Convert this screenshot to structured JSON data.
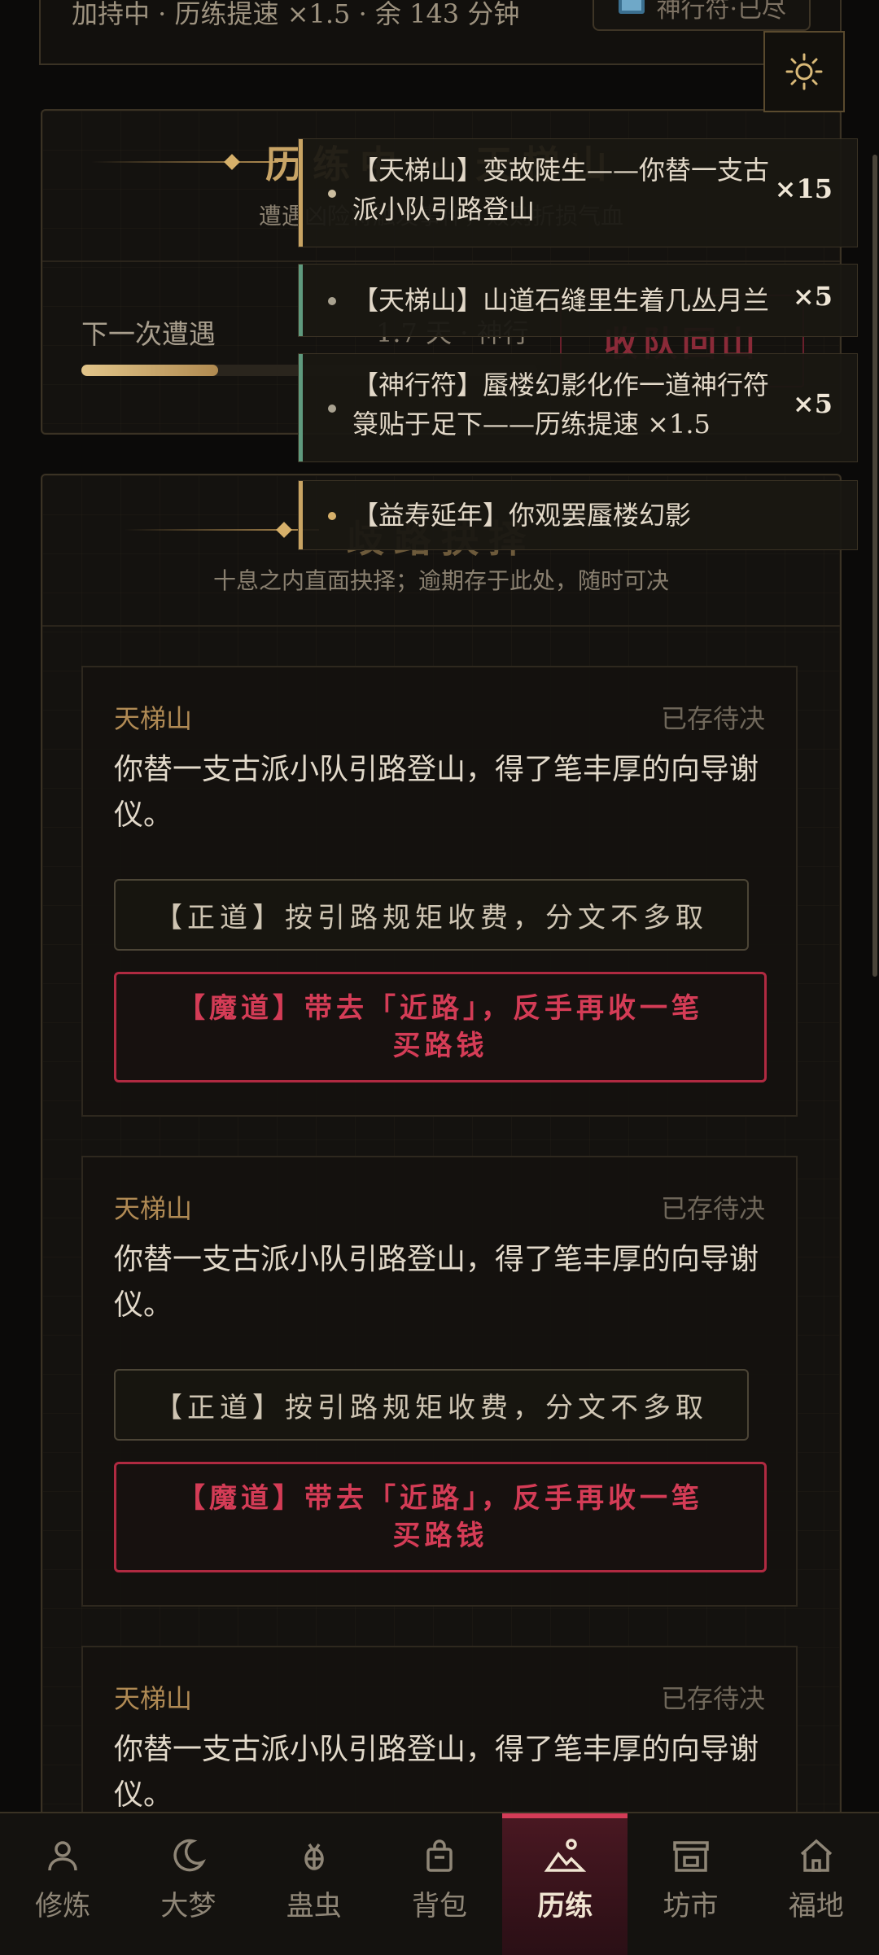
{
  "status_bar": {
    "buff_text": "加持中 · 历练提速 ×1.5 · 余 143 分钟",
    "talisman_label": "神行符·已尽",
    "talisman_icon": "tv-icon"
  },
  "journey_panel": {
    "title": "历练中 · 天梯山",
    "subtitle": "遭遇凶险将触发事件，败则折损气血",
    "next_label": "下一次遭遇",
    "next_value": "1.7 天 · 神行",
    "recall_button": "收队回山",
    "progress": 0.3
  },
  "choice_panel": {
    "title": "歧路抉择",
    "subtitle": "十息之内直面抉择；逾期存于此处，随时可决"
  },
  "toasts": [
    {
      "text": "【天梯山】变故陡生——你替一支古派小队引路登山",
      "count": "×15",
      "accent": "#c9a463"
    },
    {
      "text": "【天梯山】山道石缝里生着几丛月兰",
      "count": "×5",
      "accent": "#5f9a7e"
    },
    {
      "text": "【神行符】蜃楼幻影化作一道神行符箓贴于足下——历练提速 ×1.5",
      "count": "×5",
      "accent": "#5f9a7e"
    },
    {
      "text": "【益寿延年】你观罢蜃楼幻影",
      "count": "",
      "accent": "#c9a463"
    }
  ],
  "events": [
    {
      "location": "天梯山",
      "state": "已存待决",
      "description": "你替一支古派小队引路登山，得了笔丰厚的向导谢仪。",
      "righteous": "【正道】按引路规矩收费，分文不多取",
      "demonic": "【魔道】带去「近路」，反手再收一笔买路钱"
    },
    {
      "location": "天梯山",
      "state": "已存待决",
      "description": "你替一支古派小队引路登山，得了笔丰厚的向导谢仪。",
      "righteous": "【正道】按引路规矩收费，分文不多取",
      "demonic": "【魔道】带去「近路」，反手再收一笔买路钱"
    },
    {
      "location": "天梯山",
      "state": "已存待决",
      "description": "你替一支古派小队引路登山，得了笔丰厚的向导谢仪。"
    }
  ],
  "nav": [
    {
      "label": "修炼",
      "icon": "person-icon"
    },
    {
      "label": "大梦",
      "icon": "moon-icon"
    },
    {
      "label": "蛊虫",
      "icon": "bug-icon"
    },
    {
      "label": "背包",
      "icon": "bag-icon"
    },
    {
      "label": "历练",
      "icon": "mountain-icon",
      "active": true
    },
    {
      "label": "坊市",
      "icon": "store-icon"
    },
    {
      "label": "福地",
      "icon": "home-icon"
    }
  ],
  "colors": {
    "gold": "#c9a463",
    "crimson": "#d33c57",
    "jade": "#5f9a7e"
  }
}
